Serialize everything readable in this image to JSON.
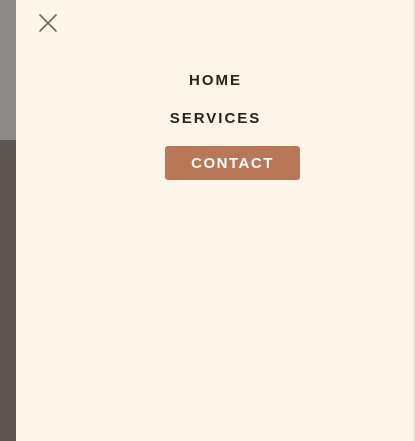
{
  "menu": {
    "close_icon": "close-icon",
    "items": [
      {
        "label": "HOME"
      },
      {
        "label": "SERVICES"
      }
    ],
    "cta_label": "CONTACT"
  },
  "colors": {
    "background": "#fdf5e8",
    "nav_text": "#2a221f",
    "cta_background": "#b97758",
    "cta_text": "#ffffff",
    "left_strip": "#5b5652"
  }
}
